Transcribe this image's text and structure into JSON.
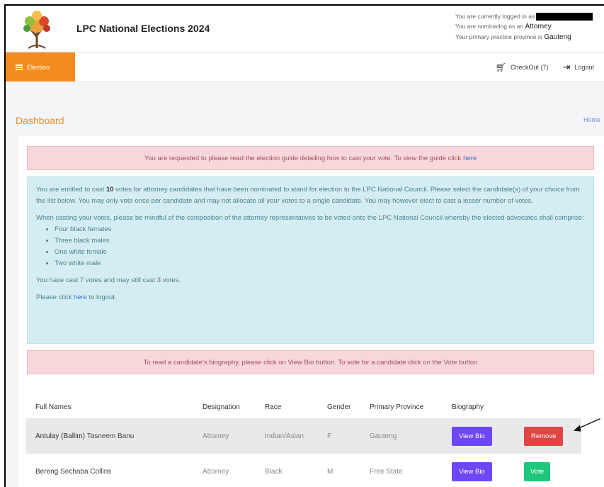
{
  "header": {
    "app_title": "LPC National Elections 2024",
    "logged_in_label": "You are currently logged in as",
    "nominating_label": "You are nominating as an",
    "nominating_role": "Attorney",
    "province_label": "Your primary practice province is",
    "province": "Gauteng"
  },
  "navbar": {
    "election_label": "Election",
    "checkout_label": "CheckOut (7)",
    "logout_label": "Logout"
  },
  "page": {
    "title": "Dashboard",
    "breadcrumb_home": "Home"
  },
  "guide_alert": {
    "text": "You are requested to please read the election guide detailing how to cast your vote. To view the guide click",
    "link": "here"
  },
  "info_alert": {
    "p1_a": "You are entitled to cast",
    "p1_votes": "10",
    "p1_b": "votes for attorney candidates that have been nominated to stand for election to the LPC National Council. Please select the candidate(s) of your choice from the list below. You may only vote once per candidate and may not allocate all your votes to a single candidate. You may however elect to cast a lesser number of votes.",
    "p2": "When casting your votes, please be mindful of the composition of the attorney representatives to be voted onto the LPC National Council whereby the elected advocates shall comprise:",
    "composition": [
      "Four black females",
      "Three black males",
      "One white female",
      "Two white male"
    ],
    "status": "You have cast 7 votes and may still cast 3 votes.",
    "logout_a": "Please click",
    "logout_link": "here",
    "logout_b": "to logout."
  },
  "bio_alert": {
    "text": "To read a candidate's biography, please click on View Bio button. To vote for a candidate click on the Vote button"
  },
  "table": {
    "headers": [
      "Full Names",
      "Designation",
      "Race",
      "Gender",
      "Primary Province",
      "Biography",
      ""
    ],
    "rows": [
      {
        "surname": "Antulay (Ballim)",
        "given": "Tasneem Banu",
        "designation": "Attorney",
        "race": "Indian/Asian",
        "gender": "F",
        "province": "Gauteng",
        "bio_label": "View Bio",
        "action_label": "Remove"
      },
      {
        "surname": "Bereng",
        "given": "Sechaba Collins",
        "designation": "Attorney",
        "race": "Black",
        "gender": "M",
        "province": "Free State",
        "bio_label": "View Bio",
        "action_label": "Vote"
      }
    ]
  },
  "colors": {
    "accent_orange": "#f28c1e",
    "view_bio": "#6c47f5",
    "remove": "#e04444",
    "vote": "#1fc77b"
  }
}
